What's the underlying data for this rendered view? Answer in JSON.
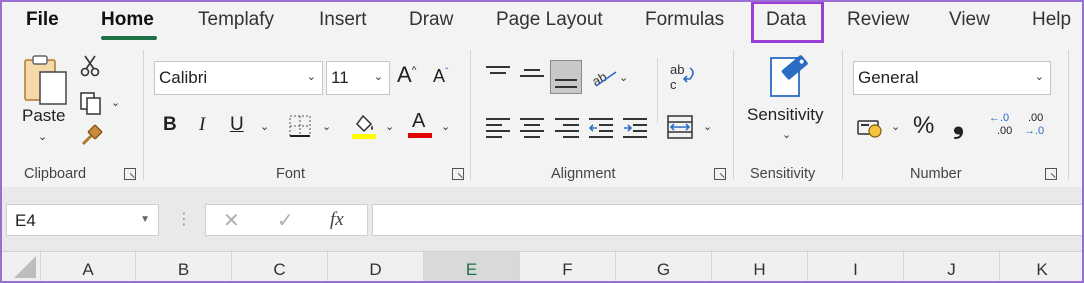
{
  "tabs": [
    {
      "label": "File"
    },
    {
      "label": "Home"
    },
    {
      "label": "Templafy"
    },
    {
      "label": "Insert"
    },
    {
      "label": "Draw"
    },
    {
      "label": "Page Layout"
    },
    {
      "label": "Formulas"
    },
    {
      "label": "Data"
    },
    {
      "label": "Review"
    },
    {
      "label": "View"
    },
    {
      "label": "Help"
    }
  ],
  "active_tab": "Home",
  "highlighted_tab": "Data",
  "colors": {
    "accent_green": "#1e7145",
    "highlight_purple": "#9b3fd6",
    "highlight_yellow": "#ffff00",
    "font_color_red": "#e00000"
  },
  "clipboard": {
    "paste_label": "Paste",
    "group_label": "Clipboard",
    "icons": [
      "paste-icon",
      "cut-icon",
      "copy-icon",
      "format-painter-icon"
    ]
  },
  "font": {
    "font_name": "Calibri",
    "font_size": "11",
    "grow_label": "A",
    "shrink_label": "A",
    "bold_label": "B",
    "italic_label": "I",
    "underline_label": "U",
    "font_color_label": "A",
    "group_label": "Font"
  },
  "alignment": {
    "wrap_label": "ab\nc",
    "group_label": "Alignment"
  },
  "sensitivity": {
    "button_label": "Sensitivity",
    "group_label": "Sensitivity"
  },
  "number": {
    "format_value": "General",
    "percent_label": "%",
    "comma_label": "❟",
    "increase_decimal_top": "←.0",
    "increase_decimal_bottom": ".00",
    "decrease_decimal_top": ".00",
    "decrease_decimal_bottom": "→.0",
    "group_label": "Number"
  },
  "formula_bar": {
    "name_box_value": "E4",
    "cancel_glyph": "✕",
    "enter_glyph": "✓",
    "fx_label": "fx",
    "formula_value": ""
  },
  "columns": [
    "A",
    "B",
    "C",
    "D",
    "E",
    "F",
    "G",
    "H",
    "I",
    "J",
    "K"
  ],
  "selected_column": "E"
}
